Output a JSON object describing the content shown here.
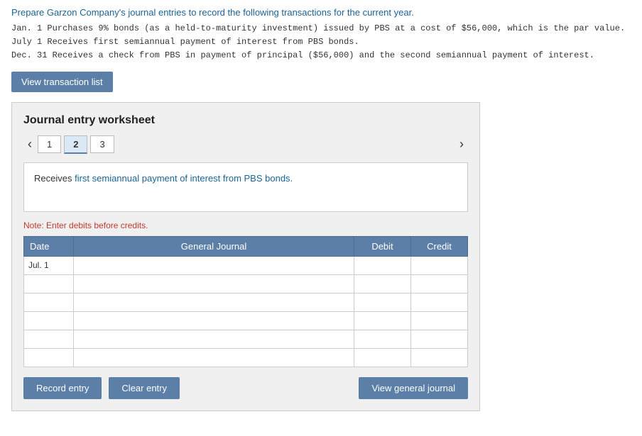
{
  "instructions": {
    "title": "Prepare Garzon Company's journal entries to record the following transactions for the current year.",
    "transactions": [
      "Jan.  1 Purchases 9% bonds (as a held-to-maturity investment) issued by PBS at a cost of $56,000, which is the par value.",
      "July  1 Receives first semiannual payment of interest from PBS bonds.",
      "Dec. 31 Receives a check from PBS in payment of principal ($56,000) and the second semiannual payment of interest."
    ]
  },
  "buttons": {
    "view_transaction_list": "View transaction list",
    "record_entry": "Record entry",
    "clear_entry": "Clear entry",
    "view_general_journal": "View general journal"
  },
  "worksheet": {
    "title": "Journal entry worksheet",
    "tabs": [
      {
        "label": "1"
      },
      {
        "label": "2",
        "active": true
      },
      {
        "label": "3"
      }
    ],
    "description": "Receives first semiannual payment of interest from PBS bonds.",
    "description_highlight": "first semiannual payment of interest from PBS bonds.",
    "note": "Note: Enter debits before credits.",
    "table": {
      "headers": [
        "Date",
        "General Journal",
        "Debit",
        "Credit"
      ],
      "rows": [
        {
          "date": "Jul. 1",
          "journal": "",
          "debit": "",
          "credit": ""
        },
        {
          "date": "",
          "journal": "",
          "debit": "",
          "credit": ""
        },
        {
          "date": "",
          "journal": "",
          "debit": "",
          "credit": ""
        },
        {
          "date": "",
          "journal": "",
          "debit": "",
          "credit": ""
        },
        {
          "date": "",
          "journal": "",
          "debit": "",
          "credit": ""
        },
        {
          "date": "",
          "journal": "",
          "debit": "",
          "credit": ""
        }
      ]
    }
  }
}
